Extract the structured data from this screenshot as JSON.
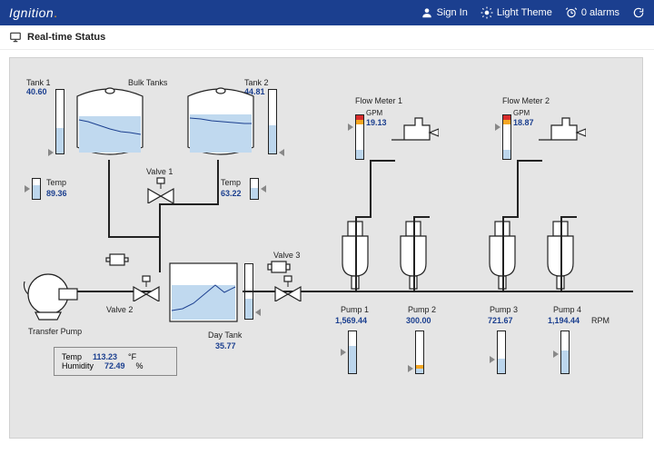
{
  "header": {
    "brand_text": "Ignition",
    "sign_in": "Sign In",
    "theme": "Light Theme",
    "alarms": "0 alarms"
  },
  "subheader": {
    "title": "Real-time Status"
  },
  "tanks": {
    "tank1": {
      "label": "Tank 1",
      "value": "40.60"
    },
    "bulk_label": "Bulk Tanks",
    "tank2": {
      "label": "Tank 2",
      "value": "44.81"
    },
    "day": {
      "label": "Day Tank",
      "value": "35.77"
    }
  },
  "temps": {
    "t1": {
      "label": "Temp",
      "value": "89.36"
    },
    "t2": {
      "label": "Temp",
      "value": "63.22"
    }
  },
  "valves": {
    "v1": "Valve 1",
    "v2": "Valve 2",
    "v3": "Valve 3"
  },
  "transfer_pump_label": "Transfer Pump",
  "flow": {
    "fm1": {
      "label": "Flow Meter 1",
      "gpm_label": "GPM",
      "value": "19.13"
    },
    "fm2": {
      "label": "Flow Meter 2",
      "gpm_label": "GPM",
      "value": "18.87"
    }
  },
  "pumps": {
    "p1": {
      "label": "Pump 1",
      "value": "1,569.44"
    },
    "p2": {
      "label": "Pump 2",
      "value": "300.00"
    },
    "p3": {
      "label": "Pump 3",
      "value": "721.67"
    },
    "p4": {
      "label": "Pump 4",
      "value": "1,194.44",
      "unit": "RPM"
    }
  },
  "ambient": {
    "temp_label": "Temp",
    "temp_value": "113.23",
    "temp_unit": "°F",
    "hum_label": "Humidity",
    "hum_value": "72.49",
    "hum_unit": "%"
  }
}
